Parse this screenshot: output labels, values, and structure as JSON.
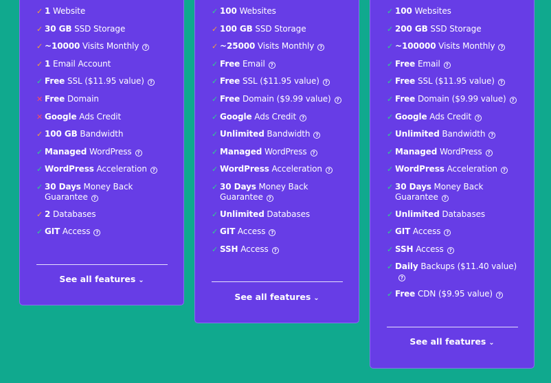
{
  "plans": [
    {
      "features": [
        {
          "icon": "check-orange",
          "bold": "1",
          "text": " Website",
          "help": false
        },
        {
          "icon": "check-orange",
          "bold": "30 GB",
          "text": " SSD Storage",
          "help": false
        },
        {
          "icon": "check-orange",
          "bold": "~10000",
          "text": " Visits Monthly",
          "help": true
        },
        {
          "icon": "check-orange",
          "bold": "1",
          "text": " Email Account",
          "help": false
        },
        {
          "icon": "check-green",
          "bold": "Free",
          "text": " SSL ($11.95 value)",
          "help": true
        },
        {
          "icon": "cross-red",
          "bold": "Free",
          "text": " Domain",
          "help": false
        },
        {
          "icon": "cross-red",
          "bold": "Google",
          "text": " Ads Credit",
          "help": false
        },
        {
          "icon": "check-orange",
          "bold": "100 GB",
          "text": " Bandwidth",
          "help": false
        },
        {
          "icon": "check-green",
          "bold": "Managed",
          "text": " WordPress",
          "help": true
        },
        {
          "icon": "check-green",
          "bold": "WordPress",
          "text": " Acceleration",
          "help": true
        },
        {
          "icon": "check-green",
          "bold": "30 Days",
          "text": " Money Back Guarantee",
          "help": true
        },
        {
          "icon": "check-orange",
          "bold": "2",
          "text": " Databases",
          "help": false
        },
        {
          "icon": "check-green",
          "bold": "GIT",
          "text": " Access",
          "help": true
        }
      ],
      "see_all_label": "See all features"
    },
    {
      "features": [
        {
          "icon": "check-green",
          "bold": "100",
          "text": " Websites",
          "help": false
        },
        {
          "icon": "check-orange",
          "bold": "100 GB",
          "text": " SSD Storage",
          "help": false
        },
        {
          "icon": "check-orange",
          "bold": "~25000",
          "text": " Visits Monthly",
          "help": true
        },
        {
          "icon": "check-green",
          "bold": "Free",
          "text": " Email",
          "help": true
        },
        {
          "icon": "check-green",
          "bold": "Free",
          "text": " SSL ($11.95 value)",
          "help": true
        },
        {
          "icon": "check-green",
          "bold": "Free",
          "text": " Domain ($9.99 value)",
          "help": true
        },
        {
          "icon": "check-green",
          "bold": "Google",
          "text": " Ads Credit",
          "help": true
        },
        {
          "icon": "check-green",
          "bold": "Unlimited",
          "text": " Bandwidth",
          "help": true
        },
        {
          "icon": "check-green",
          "bold": "Managed",
          "text": " WordPress",
          "help": true
        },
        {
          "icon": "check-green",
          "bold": "WordPress",
          "text": " Acceleration",
          "help": true
        },
        {
          "icon": "check-green",
          "bold": "30 Days",
          "text": " Money Back Guarantee",
          "help": true
        },
        {
          "icon": "check-green",
          "bold": "Unlimited",
          "text": " Databases",
          "help": false
        },
        {
          "icon": "check-green",
          "bold": "GIT",
          "text": " Access",
          "help": true
        },
        {
          "icon": "check-green",
          "bold": "SSH",
          "text": " Access",
          "help": true
        }
      ],
      "see_all_label": "See all features"
    },
    {
      "features": [
        {
          "icon": "check-green",
          "bold": "100",
          "text": " Websites",
          "help": false
        },
        {
          "icon": "check-green",
          "bold": "200 GB",
          "text": " SSD Storage",
          "help": false
        },
        {
          "icon": "check-green",
          "bold": "~100000",
          "text": " Visits Monthly",
          "help": true
        },
        {
          "icon": "check-green",
          "bold": "Free",
          "text": " Email",
          "help": true
        },
        {
          "icon": "check-green",
          "bold": "Free",
          "text": " SSL ($11.95 value)",
          "help": true
        },
        {
          "icon": "check-green",
          "bold": "Free",
          "text": " Domain ($9.99 value)",
          "help": true
        },
        {
          "icon": "check-green",
          "bold": "Google",
          "text": " Ads Credit",
          "help": true
        },
        {
          "icon": "check-green",
          "bold": "Unlimited",
          "text": " Bandwidth",
          "help": true
        },
        {
          "icon": "check-green",
          "bold": "Managed",
          "text": " WordPress",
          "help": true
        },
        {
          "icon": "check-green",
          "bold": "WordPress",
          "text": " Acceleration",
          "help": true
        },
        {
          "icon": "check-green",
          "bold": "30 Days",
          "text": " Money Back Guarantee",
          "help": true
        },
        {
          "icon": "check-green",
          "bold": "Unlimited",
          "text": " Databases",
          "help": false
        },
        {
          "icon": "check-green",
          "bold": "GIT",
          "text": " Access",
          "help": true
        },
        {
          "icon": "check-green",
          "bold": "SSH",
          "text": " Access",
          "help": true
        },
        {
          "icon": "check-green",
          "bold": "Daily",
          "text": " Backups ($11.40 value)",
          "help": true
        },
        {
          "icon": "check-green",
          "bold": "Free",
          "text": " CDN ($9.95 value)",
          "help": true
        }
      ],
      "see_all_label": "See all features"
    }
  ],
  "colors": {
    "background": "#10a98e",
    "card": "#673de6",
    "check_green": "#2fd18d",
    "check_orange": "#f3a13a",
    "cross_red": "#ff4d5e"
  }
}
